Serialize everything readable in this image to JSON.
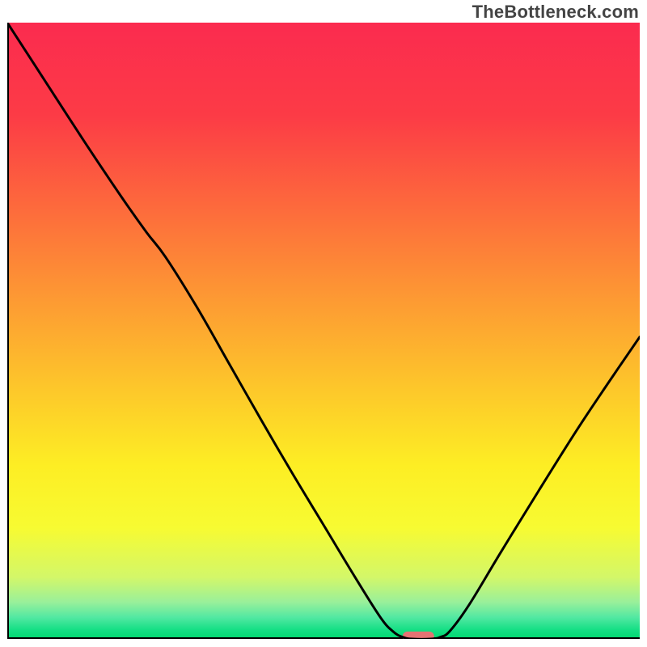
{
  "watermark": "TheBottleneck.com",
  "chart_data": {
    "type": "line",
    "title": "",
    "xlabel": "",
    "ylabel": "",
    "xlim": [
      0,
      100
    ],
    "ylim": [
      0,
      100
    ],
    "grid": false,
    "gradient_stops": [
      {
        "offset": 0.0,
        "color": "#fb2b4f"
      },
      {
        "offset": 0.15,
        "color": "#fc3b46"
      },
      {
        "offset": 0.3,
        "color": "#fd6a3c"
      },
      {
        "offset": 0.45,
        "color": "#fd9a33"
      },
      {
        "offset": 0.6,
        "color": "#fdc92a"
      },
      {
        "offset": 0.72,
        "color": "#fdee24"
      },
      {
        "offset": 0.82,
        "color": "#f7fb32"
      },
      {
        "offset": 0.9,
        "color": "#d3f769"
      },
      {
        "offset": 0.94,
        "color": "#9af09a"
      },
      {
        "offset": 0.965,
        "color": "#52e8a2"
      },
      {
        "offset": 0.985,
        "color": "#16df85"
      },
      {
        "offset": 1.0,
        "color": "#00d870"
      }
    ],
    "curve": [
      {
        "x": 0.0,
        "y": 100.0
      },
      {
        "x": 6.0,
        "y": 90.5
      },
      {
        "x": 12.0,
        "y": 81.0
      },
      {
        "x": 18.0,
        "y": 71.8
      },
      {
        "x": 22.0,
        "y": 66.0
      },
      {
        "x": 25.0,
        "y": 62.0
      },
      {
        "x": 30.0,
        "y": 53.8
      },
      {
        "x": 35.0,
        "y": 44.8
      },
      {
        "x": 40.0,
        "y": 35.8
      },
      {
        "x": 45.0,
        "y": 27.0
      },
      {
        "x": 50.0,
        "y": 18.5
      },
      {
        "x": 55.0,
        "y": 10.0
      },
      {
        "x": 59.0,
        "y": 3.5
      },
      {
        "x": 61.0,
        "y": 1.2
      },
      {
        "x": 62.5,
        "y": 0.3
      },
      {
        "x": 64.0,
        "y": 0.0
      },
      {
        "x": 67.0,
        "y": 0.0
      },
      {
        "x": 68.5,
        "y": 0.3
      },
      {
        "x": 70.0,
        "y": 1.3
      },
      {
        "x": 73.0,
        "y": 5.5
      },
      {
        "x": 78.0,
        "y": 14.0
      },
      {
        "x": 84.0,
        "y": 24.0
      },
      {
        "x": 90.0,
        "y": 33.8
      },
      {
        "x": 95.0,
        "y": 41.5
      },
      {
        "x": 100.0,
        "y": 49.0
      }
    ],
    "marker": {
      "x": 65.0,
      "y": 0.4,
      "width": 5.0,
      "height": 1.6,
      "color": "#e57373"
    },
    "axes_color": "#000000",
    "curve_color": "#000000",
    "curve_width": 3
  }
}
